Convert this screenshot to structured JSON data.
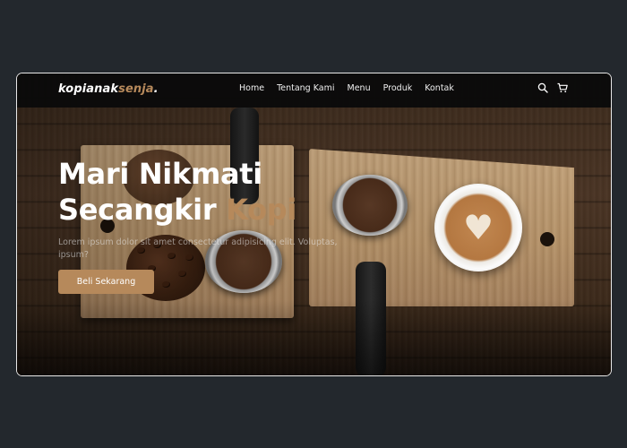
{
  "brand": {
    "name_main": "kopianak",
    "name_accent": "senja",
    "name_suffix": "."
  },
  "nav": {
    "links": [
      "Home",
      "Tentang Kami",
      "Menu",
      "Produk",
      "Kontak"
    ],
    "icons": [
      "search-icon",
      "cart-icon"
    ]
  },
  "hero": {
    "title_line1": "Mari Nikmati",
    "title_line2_main": "Secangkir ",
    "title_line2_accent": "Kopi",
    "subtitle": "Lorem ipsum dolor sit amet consectetur adipisicing elit. Voluptas, ipsum?",
    "cta_label": "Beli Sekarang"
  },
  "colors": {
    "accent": "#b6895b",
    "page_bg": "#23282d",
    "navbar_bg": "#0a0a0a"
  }
}
